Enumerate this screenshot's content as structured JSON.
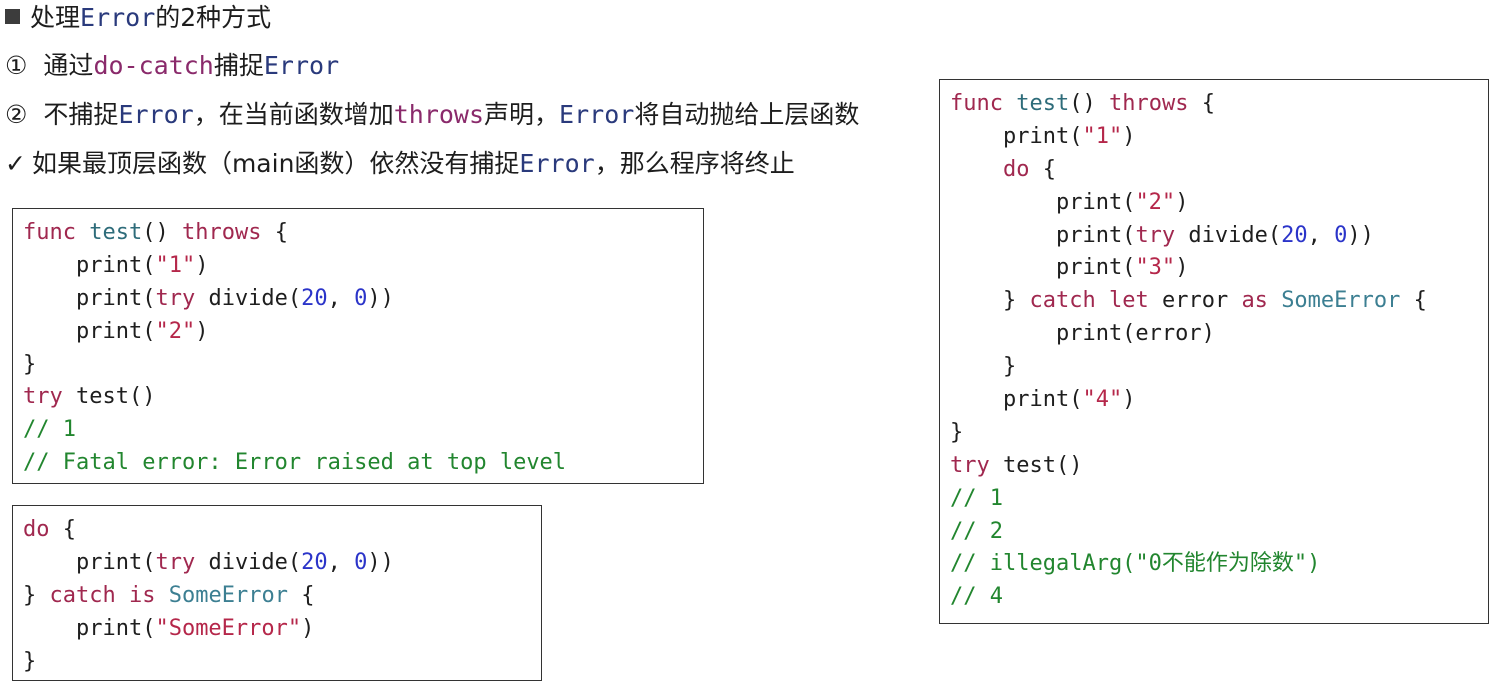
{
  "heading": {
    "bullet_icon": "square-bullet-icon",
    "text_before": "处理",
    "code_word": "Error",
    "text_after": "的2种方式"
  },
  "option1": {
    "marker": "①",
    "text_before": "通过",
    "code_word": "do-catch",
    "text_middle": "捕捉",
    "code_word2": "Error"
  },
  "option2": {
    "marker": "②",
    "text_before": "不捕捉",
    "code_word": "Error",
    "text_middle": "，在当前函数增加",
    "code_word2": "throws",
    "text_middle2": "声明，",
    "code_word3": "Error",
    "text_after": "将自动抛给上层函数"
  },
  "note": {
    "check_icon": "✓",
    "text_before": "如果最顶层函数（main函数）依然没有捕捉",
    "code_word": "Error",
    "text_after": "，那么程序将终止"
  },
  "code_block_1": {
    "lines": [
      [
        {
          "t": "func",
          "c": "kw"
        },
        {
          "t": " "
        },
        {
          "t": "test",
          "c": "fn"
        },
        {
          "t": "() "
        },
        {
          "t": "throws",
          "c": "kw"
        },
        {
          "t": " {"
        }
      ],
      [
        {
          "t": "    print("
        },
        {
          "t": "\"1\"",
          "c": "str"
        },
        {
          "t": ")"
        }
      ],
      [
        {
          "t": "    print("
        },
        {
          "t": "try",
          "c": "kw"
        },
        {
          "t": " divide("
        },
        {
          "t": "20",
          "c": "num"
        },
        {
          "t": ", "
        },
        {
          "t": "0",
          "c": "num"
        },
        {
          "t": "))"
        }
      ],
      [
        {
          "t": "    print("
        },
        {
          "t": "\"2\"",
          "c": "str"
        },
        {
          "t": ")"
        }
      ],
      [
        {
          "t": "}"
        }
      ],
      [
        {
          "t": "try",
          "c": "kw"
        },
        {
          "t": " test()"
        }
      ],
      [
        {
          "t": "// 1",
          "c": "cm"
        }
      ],
      [
        {
          "t": "// Fatal error: Error raised at top level",
          "c": "cm"
        }
      ]
    ]
  },
  "code_block_2": {
    "lines": [
      [
        {
          "t": "do",
          "c": "kw"
        },
        {
          "t": " {"
        }
      ],
      [
        {
          "t": "    print("
        },
        {
          "t": "try",
          "c": "kw"
        },
        {
          "t": " divide("
        },
        {
          "t": "20",
          "c": "num"
        },
        {
          "t": ", "
        },
        {
          "t": "0",
          "c": "num"
        },
        {
          "t": "))"
        }
      ],
      [
        {
          "t": "} "
        },
        {
          "t": "catch",
          "c": "kw"
        },
        {
          "t": " "
        },
        {
          "t": "is",
          "c": "kw"
        },
        {
          "t": " "
        },
        {
          "t": "SomeError",
          "c": "ty"
        },
        {
          "t": " {"
        }
      ],
      [
        {
          "t": "    print("
        },
        {
          "t": "\"SomeError\"",
          "c": "str"
        },
        {
          "t": ")"
        }
      ],
      [
        {
          "t": "}"
        }
      ]
    ]
  },
  "code_block_3": {
    "lines": [
      [
        {
          "t": "func",
          "c": "kw"
        },
        {
          "t": " "
        },
        {
          "t": "test",
          "c": "fn"
        },
        {
          "t": "() "
        },
        {
          "t": "throws",
          "c": "kw"
        },
        {
          "t": " {"
        }
      ],
      [
        {
          "t": "    print("
        },
        {
          "t": "\"1\"",
          "c": "str"
        },
        {
          "t": ")"
        }
      ],
      [
        {
          "t": "    "
        },
        {
          "t": "do",
          "c": "kw"
        },
        {
          "t": " {"
        }
      ],
      [
        {
          "t": "        print("
        },
        {
          "t": "\"2\"",
          "c": "str"
        },
        {
          "t": ")"
        }
      ],
      [
        {
          "t": "        print("
        },
        {
          "t": "try",
          "c": "kw"
        },
        {
          "t": " divide("
        },
        {
          "t": "20",
          "c": "num"
        },
        {
          "t": ", "
        },
        {
          "t": "0",
          "c": "num"
        },
        {
          "t": "))"
        }
      ],
      [
        {
          "t": "        print("
        },
        {
          "t": "\"3\"",
          "c": "str"
        },
        {
          "t": ")"
        }
      ],
      [
        {
          "t": "    } "
        },
        {
          "t": "catch",
          "c": "kw"
        },
        {
          "t": " "
        },
        {
          "t": "let",
          "c": "kw"
        },
        {
          "t": " error "
        },
        {
          "t": "as",
          "c": "kw"
        },
        {
          "t": " "
        },
        {
          "t": "SomeError",
          "c": "ty"
        },
        {
          "t": " {"
        }
      ],
      [
        {
          "t": "        print(error)"
        }
      ],
      [
        {
          "t": "    }"
        }
      ],
      [
        {
          "t": "    print("
        },
        {
          "t": "\"4\"",
          "c": "str"
        },
        {
          "t": ")"
        }
      ],
      [
        {
          "t": "}"
        }
      ],
      [
        {
          "t": "try",
          "c": "kw"
        },
        {
          "t": " test()"
        }
      ],
      [
        {
          "t": "// 1",
          "c": "cm"
        }
      ],
      [
        {
          "t": "// 2",
          "c": "cm"
        }
      ],
      [
        {
          "t": "// illegalArg(\"0不能作为除数\")",
          "c": "cm"
        }
      ],
      [
        {
          "t": "// 4",
          "c": "cm"
        }
      ]
    ]
  }
}
